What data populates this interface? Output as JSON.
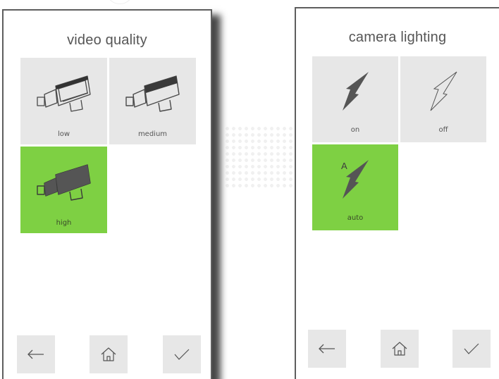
{
  "left_panel": {
    "title": "video quality",
    "options": [
      {
        "label": "low",
        "icon": "camera-low-icon",
        "selected": false
      },
      {
        "label": "medium",
        "icon": "camera-medium-icon",
        "selected": false
      },
      {
        "label": "high",
        "icon": "camera-high-icon",
        "selected": true
      }
    ],
    "nav": {
      "back_icon": "arrow-left-icon",
      "home_icon": "home-icon",
      "confirm_icon": "checkmark-icon"
    }
  },
  "right_panel": {
    "title": "camera lighting",
    "options": [
      {
        "label": "on",
        "icon": "lightning-on-icon",
        "selected": false
      },
      {
        "label": "off",
        "icon": "lightning-off-icon",
        "selected": false
      },
      {
        "label": "auto",
        "icon": "lightning-auto-icon",
        "badge": "A",
        "selected": true
      }
    ],
    "nav": {
      "back_icon": "arrow-left-icon",
      "home_icon": "home-icon",
      "confirm_icon": "checkmark-icon"
    }
  },
  "colors": {
    "selected": "#7ed043",
    "tile": "#e7e7e7",
    "text": "#555555",
    "border": "#5e5e5e"
  }
}
